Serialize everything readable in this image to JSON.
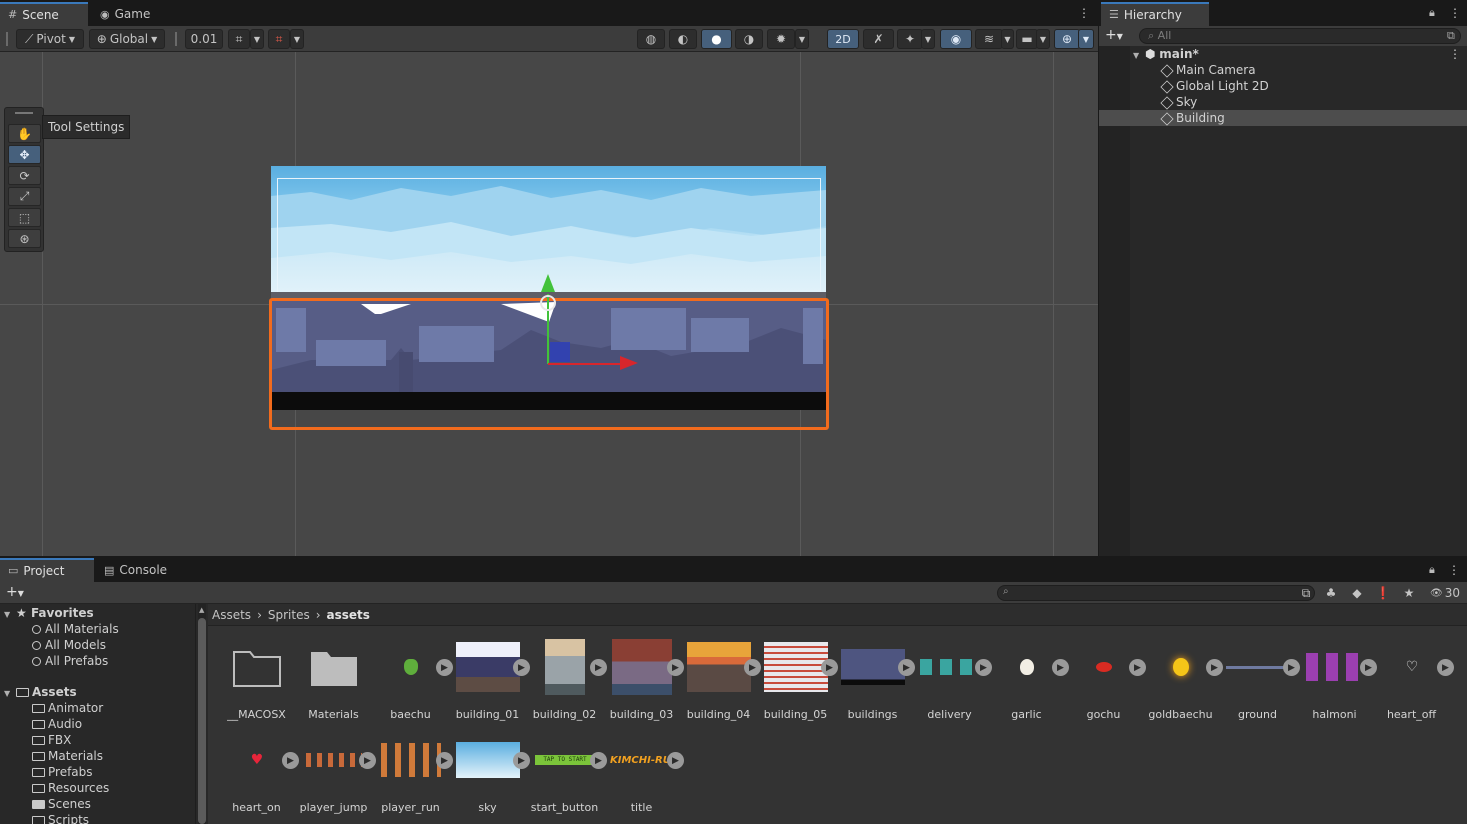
{
  "scene_tabs": {
    "scene": "Scene",
    "game": "Game",
    "menu": "⋮"
  },
  "toolbar": {
    "pivot": "Pivot",
    "global": "Global",
    "snap_value": "0.01",
    "mode_2d": "2D"
  },
  "tool_settings": {
    "label": "Tool Settings"
  },
  "hierarchy": {
    "title": "Hierarchy",
    "search_placeholder": "All",
    "scene_name": "main*",
    "items": [
      {
        "label": "Main Camera",
        "selected": false
      },
      {
        "label": "Global Light 2D",
        "selected": false
      },
      {
        "label": "Sky",
        "selected": false
      },
      {
        "label": "Building",
        "selected": true
      }
    ]
  },
  "project": {
    "tab_project": "Project",
    "tab_console": "Console",
    "hidden_count": "30",
    "favorites": {
      "label": "Favorites",
      "items": [
        "All Materials",
        "All Models",
        "All Prefabs"
      ]
    },
    "assets": {
      "label": "Assets",
      "folders": [
        "Animator",
        "Audio",
        "FBX",
        "Materials",
        "Prefabs",
        "Resources",
        "Scenes",
        "Scripts"
      ]
    },
    "breadcrumb": [
      "Assets",
      "Sprites",
      "assets"
    ],
    "grid_assets": [
      {
        "name": "__MACOSX",
        "kind": "folder"
      },
      {
        "name": "Materials",
        "kind": "folder"
      },
      {
        "name": "baechu",
        "kind": "sprite"
      },
      {
        "name": "building_01",
        "kind": "sprite"
      },
      {
        "name": "building_02",
        "kind": "sprite"
      },
      {
        "name": "building_03",
        "kind": "sprite"
      },
      {
        "name": "building_04",
        "kind": "sprite"
      },
      {
        "name": "building_05",
        "kind": "sprite"
      },
      {
        "name": "buildings",
        "kind": "sprite"
      },
      {
        "name": "delivery",
        "kind": "sprite"
      },
      {
        "name": "garlic",
        "kind": "sprite"
      },
      {
        "name": "gochu",
        "kind": "sprite"
      },
      {
        "name": "goldbaechu",
        "kind": "sprite"
      },
      {
        "name": "ground",
        "kind": "sprite"
      },
      {
        "name": "halmoni",
        "kind": "sprite"
      },
      {
        "name": "heart_off",
        "kind": "sprite"
      },
      {
        "name": "heart_on",
        "kind": "sprite"
      },
      {
        "name": "player_jump",
        "kind": "sprite"
      },
      {
        "name": "player_run",
        "kind": "sprite"
      },
      {
        "name": "sky",
        "kind": "sprite"
      },
      {
        "name": "start_button",
        "kind": "sprite"
      },
      {
        "name": "title",
        "kind": "sprite"
      }
    ],
    "thumb_text": {
      "start_button": "TAP TO START",
      "title": "KIMCHI-RU"
    }
  },
  "colors": {
    "accent": "#3a79bb",
    "selection_outline": "#f26b1d",
    "panel": "#282828",
    "viewport": "#474747"
  }
}
